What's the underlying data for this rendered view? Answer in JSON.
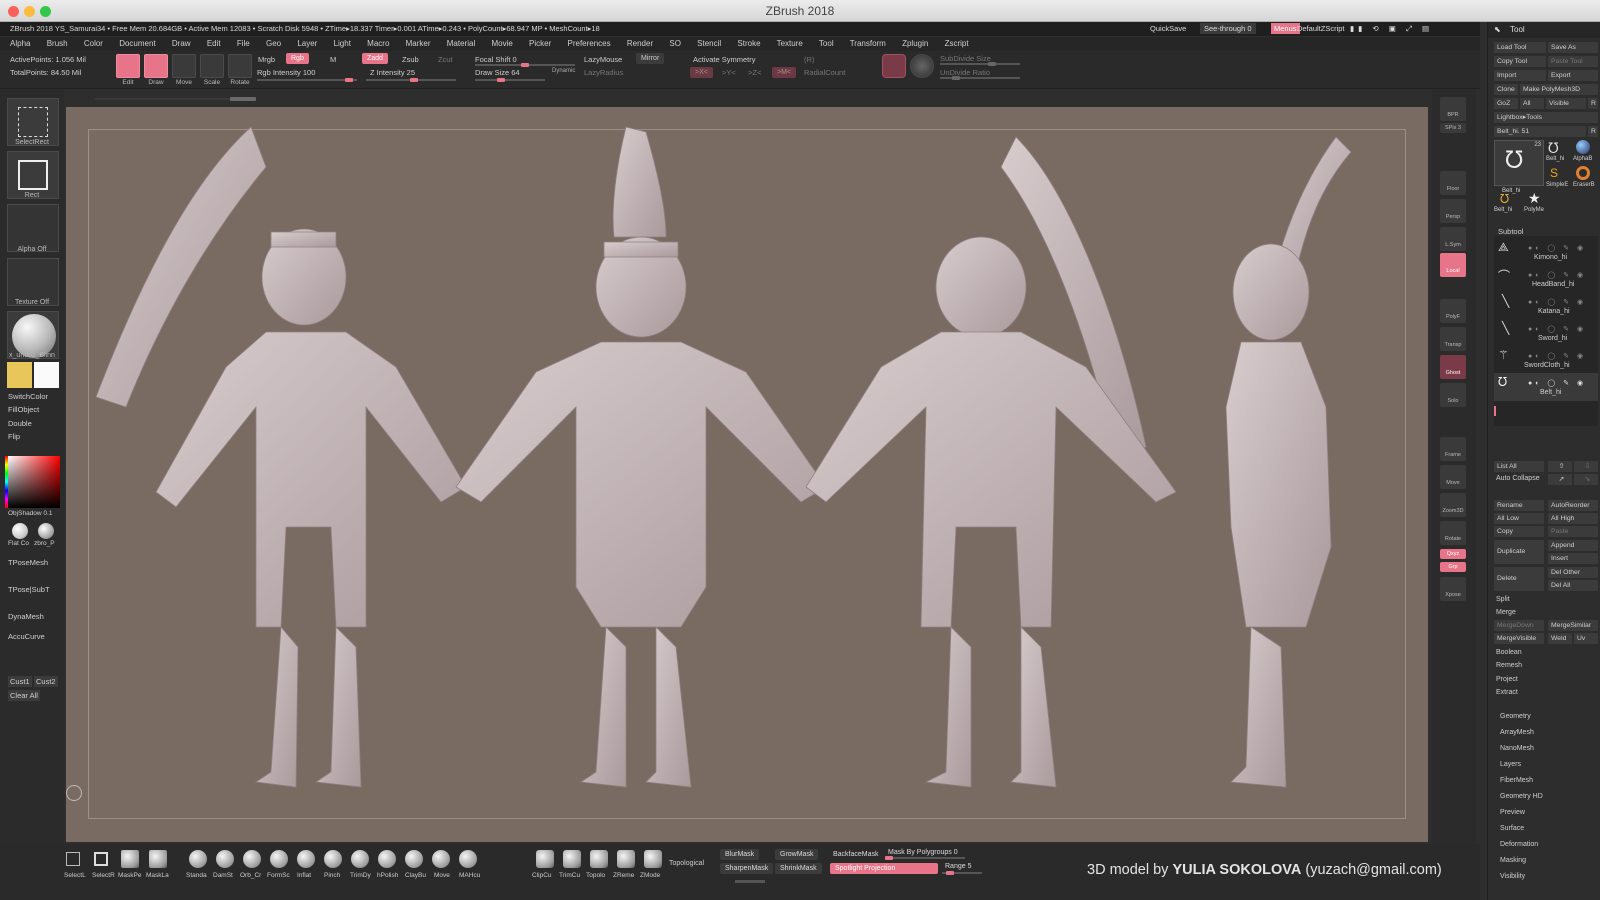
{
  "window": {
    "title": "ZBrush 2018"
  },
  "infobar": {
    "text": "ZBrush 2018 YS_Samurai34   • Free Mem 20.684GB • Active Mem 12083 • Scratch Disk 5948 •  ZTime▸18.337 Timer▸0.001 ATime▸0.243 • PolyCount▸68.947 MP  • MeshCount▸18",
    "quicksave": "QuickSave",
    "see_through": "See-through  0",
    "menus": "Menus",
    "default_zscript": "DefaultZScript"
  },
  "menubar": [
    "Alpha",
    "Brush",
    "Color",
    "Document",
    "Draw",
    "Edit",
    "File",
    "Geo",
    "Layer",
    "Light",
    "Macro",
    "Marker",
    "Material",
    "Movie",
    "Picker",
    "Preferences",
    "Render",
    "SO",
    "Stencil",
    "Stroke",
    "Texture",
    "Tool",
    "Transform",
    "Zplugin",
    "Zscript"
  ],
  "toolbar": {
    "active_points": "ActivePoints: 1.056 Mil",
    "total_points": "TotalPoints: 84.50 Mil",
    "edit": "Edit",
    "draw": "Draw",
    "move": "Move",
    "scale": "Scale",
    "rotate": "Rotate",
    "mrgb": "Mrgb",
    "rgb": "Rgb",
    "m": "M",
    "rgb_intensity": "Rgb Intensity 100",
    "zadd": "Zadd",
    "zsub": "Zsub",
    "zcut": "Zcut",
    "z_intensity": "Z Intensity 25",
    "focal_shift": "Focal Shift 0",
    "draw_size": "Draw Size 64",
    "dynamic": "Dynamic",
    "lazymouse": "LazyMouse",
    "lazyradius": "LazyRadius",
    "mirror": "Mirror",
    "activate_symmetry": "Activate Symmetry",
    "radialcount": "RadialCount",
    "subdivide_size": "SubDivide Size",
    "undivide_ratio": "UnDivide Ratio",
    "xyz_x": ">X<",
    "xyz_y": ">Y<",
    "xyz_z": ">Z<",
    "xyz_m": ">M<",
    "r": "(R)"
  },
  "leftshelf": {
    "selectrect": "SelectRect",
    "rect": "Rect",
    "alpha_off": "Alpha Off",
    "texture_off": "Texture Off",
    "material": "x_undoz_Blinn",
    "switchcolor": "SwitchColor",
    "fillobject": "FillObject",
    "double": "Double",
    "flip": "Flip",
    "objshadow": "ObjShadow 0.1",
    "flat_co": "Flat Co",
    "zbro_p": "zbro_P",
    "tposemesh": "TPoseMesh",
    "tposesubt": "TPose|SubT",
    "dynamesh": "DynaMesh",
    "accucurve": "AccuCurve",
    "cust1": "Cust1",
    "cust2": "Cust2",
    "clear_all": "Clear All"
  },
  "rightshelf": [
    "BPR",
    "SPix 3",
    "Floor",
    "Persp",
    "L.Sym",
    "Local",
    "PolyF",
    "Transp",
    "Ghost",
    "Solo",
    "Frame",
    "Move",
    "Zoom3D",
    "Rotate",
    "Qxyz",
    "Grp",
    "Xpose"
  ],
  "tray": {
    "header": "Tool",
    "load_tool": "Load Tool",
    "save_as": "Save As",
    "copy_tool": "Copy Tool",
    "paste_tool": "Paste Tool",
    "import": "Import",
    "export": "Export",
    "clone": "Clone",
    "make_polymesh": "Make PolyMesh3D",
    "goz": "GoZ",
    "all": "All",
    "visible": "Visible",
    "r": "R",
    "lightbox_tools": "Lightbox▸Tools",
    "belt_slider": "Belt_hi. 51",
    "thumbs": [
      "Belt_hi",
      "Belt_hi",
      "AlphaB",
      "SimpleE",
      "EraserB",
      "Belt_hi",
      "PolyMe"
    ],
    "thumb_count": "23",
    "subtool_header": "Subtool",
    "subtools": [
      "Kimono_hi",
      "HeadBand_hi",
      "Katana_hi",
      "Sword_hi",
      "SwordCloth_hi",
      "Belt_hi"
    ],
    "list_all": "List All",
    "auto_collapse": "Auto Collapse",
    "rename": "Rename",
    "autoreorder": "AutoReorder",
    "all_low": "All Low",
    "all_high": "All High",
    "copy": "Copy",
    "paste": "Paste",
    "duplicate": "Duplicate",
    "append": "Append",
    "insert": "Insert",
    "delete": "Delete",
    "del_other": "Del Other",
    "del_all": "Del All",
    "split": "Split",
    "merge": "Merge",
    "mergedown": "MergeDown",
    "mergesimilar": "MergeSimilar",
    "mergevisible": "MergeVisible",
    "weld": "Weld",
    "uv": "Uv",
    "boolean": "Boolean",
    "remesh": "Remesh",
    "project": "Project",
    "extract": "Extract",
    "sections": [
      "Geometry",
      "ArrayMesh",
      "NanoMesh",
      "Layers",
      "FiberMesh",
      "Geometry HD",
      "Preview",
      "Surface",
      "Deformation",
      "Masking",
      "Visibility"
    ]
  },
  "bottom": {
    "select_tools": [
      "SelectL",
      "SelectR",
      "MaskPe",
      "MaskLa"
    ],
    "brushes": [
      "Standa",
      "DamSt",
      "Orb_Cr",
      "FormSc",
      "Inflat",
      "Pinch",
      "TrimDy",
      "hPolish",
      "ClayBu",
      "Move",
      "MAHcu"
    ],
    "clip_tools": [
      "ClipCu",
      "TrimCu",
      "Topolo",
      "ZReme",
      "ZMode"
    ],
    "topological": "Topological",
    "blurmask": "BlurMask",
    "growmask": "GrowMask",
    "backfacemask": "BackfaceMask",
    "mask_by_polygroups": "Mask By Polygroups 0",
    "sharpenmask": "SharpenMask",
    "shrinkmask": "ShrinkMask",
    "spotlight": "Spotlight Projection",
    "range": "Range 5"
  },
  "credit": {
    "prefix": "3D model by ",
    "name": "YULIA SOKOLOVA",
    "email": " (yuzach@gmail.com)"
  },
  "colors": {
    "accent": "#e8748a",
    "canvas": "#7a6b62",
    "model": "#c9bcbd",
    "primary_color": "#e8c65a"
  }
}
